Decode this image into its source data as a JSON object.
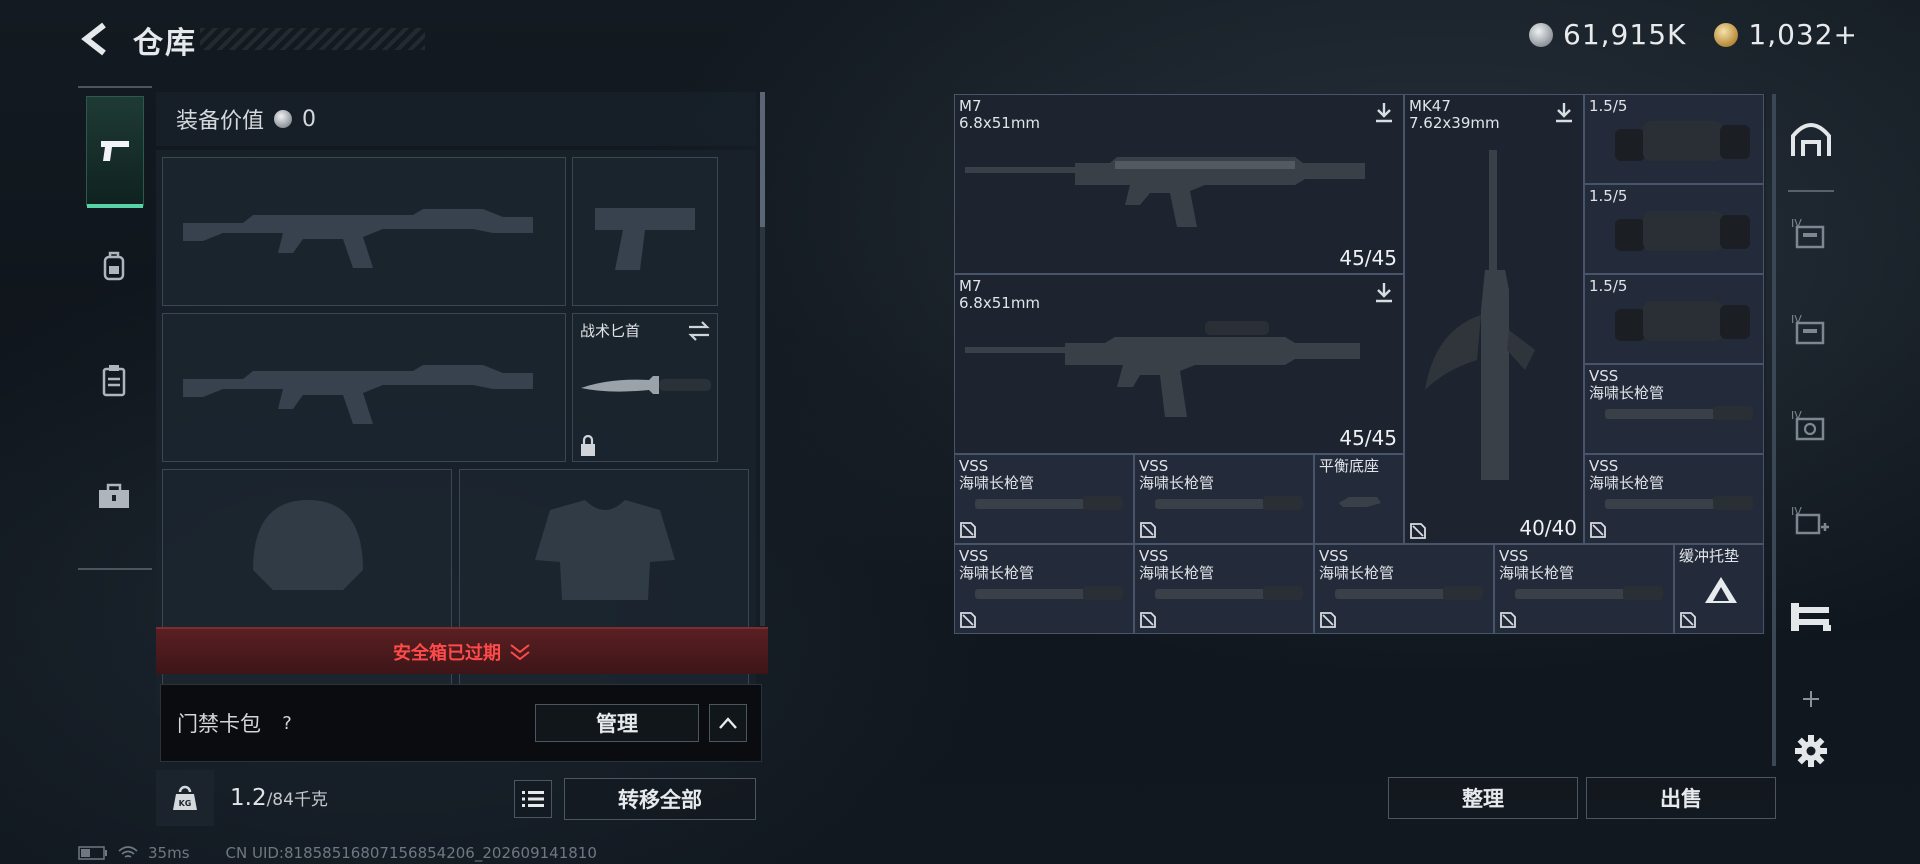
{
  "header": {
    "title": "仓库"
  },
  "currency": {
    "silver": "61,915K",
    "gold": "1,032+"
  },
  "loadout": {
    "label": "装备价值",
    "value": "0"
  },
  "knife_slot": {
    "label": "战术匕首"
  },
  "safe_box": {
    "label": "安全箱已过期"
  },
  "keycard": {
    "label": "门禁卡包",
    "help": "?",
    "manage_label": "管理"
  },
  "weight": {
    "current": "1.2",
    "max": "/84千克"
  },
  "transfer_label": "转移全部",
  "status": {
    "ping": "35ms",
    "uid": "CN UID:81858516807156854206_202609141810"
  },
  "stash": {
    "m7_1": {
      "name": "M7",
      "caliber": "6.8x51mm",
      "ammo": "45/45"
    },
    "m7_2": {
      "name": "M7",
      "caliber": "6.8x51mm",
      "ammo": "45/45"
    },
    "mk47": {
      "name": "MK47",
      "caliber": "7.62x39mm",
      "ammo": "40/40"
    },
    "scopes": [
      "1.5/5",
      "1.5/5",
      "1.5/5"
    ],
    "vss": "VSS",
    "barrel": "海啸长枪管",
    "balance": "平衡底座",
    "buffer": "缓冲托垫"
  },
  "actions": {
    "tidy": "整理",
    "sell": "出售"
  },
  "icons": {
    "back": "back-arrow-icon",
    "pistol": "pistol-icon",
    "backpack": "backpack-icon",
    "vest": "vest-icon",
    "toolbox": "toolbox-icon",
    "settings": "gear-icon"
  },
  "colors": {
    "accent": "#58d3a7",
    "danger": "#ff4a4a",
    "cell_bg": "#232a3a"
  }
}
